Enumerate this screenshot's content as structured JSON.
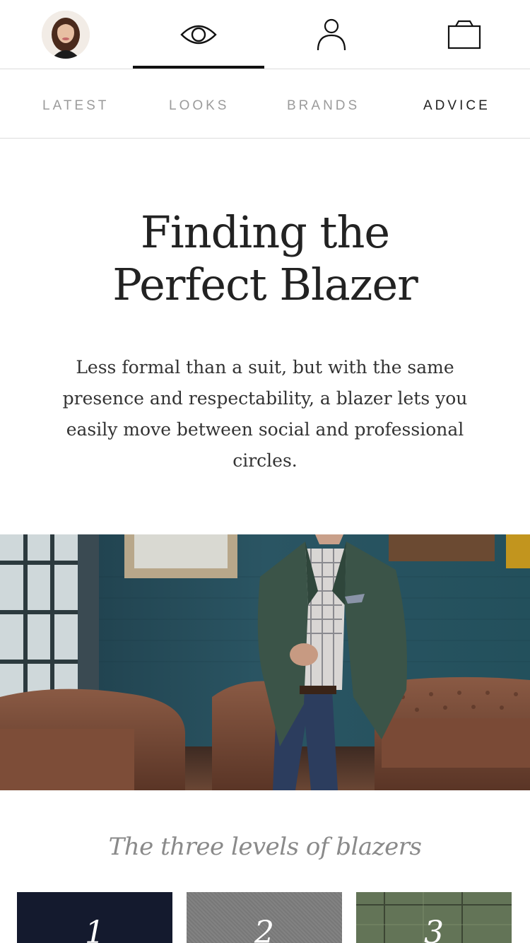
{
  "topbar": {
    "items": [
      {
        "icon": "avatar",
        "label": ""
      },
      {
        "icon": "eye-icon",
        "label": ""
      },
      {
        "icon": "user-icon",
        "label": ""
      },
      {
        "icon": "shopping-bag-icon",
        "label": ""
      }
    ],
    "active_index": 1
  },
  "categories": [
    {
      "label": "LATEST"
    },
    {
      "label": "LOOKS"
    },
    {
      "label": "BRANDS"
    },
    {
      "label": "ADVICE"
    }
  ],
  "active_category": "ADVICE",
  "article": {
    "title_line1": "Finding the",
    "title_line2": "Perfect Blazer",
    "intro": "Less formal than a suit, but with the same presence and respectability, a blazer lets you easily move between social and professional circles."
  },
  "section": {
    "title": "The three levels of blazers",
    "levels": [
      {
        "number": "1"
      },
      {
        "number": "2"
      },
      {
        "number": "3"
      }
    ]
  },
  "colors": {
    "active": "#111111",
    "muted": "#9b9b9b",
    "divider": "#dcdcdc",
    "level1": "#141a2e",
    "level2": "#7d7d7d",
    "level3": "#5e6b4f"
  }
}
